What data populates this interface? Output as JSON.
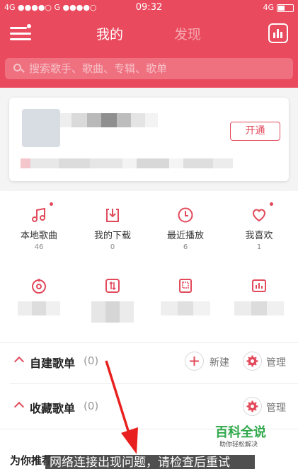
{
  "status_bar": {
    "carrier_left": "4G ●●●●○ G ●●●●○",
    "time": "09:32",
    "network_right": "4G"
  },
  "header": {
    "tabs": [
      {
        "label": "我的"
      },
      {
        "label": "发现"
      }
    ]
  },
  "search": {
    "placeholder": "搜索歌手、歌曲、专辑、歌单"
  },
  "profile": {
    "open_button_label": "开通"
  },
  "quick_grid": [
    {
      "label": "本地歌曲",
      "count": "46",
      "icon": "music-note-icon",
      "has_dot": true
    },
    {
      "label": "我的下载",
      "count": "0",
      "icon": "download-icon",
      "has_dot": false
    },
    {
      "label": "最近播放",
      "count": "6",
      "icon": "clock-icon",
      "has_dot": false
    },
    {
      "label": "我喜欢",
      "count": "1",
      "icon": "heart-icon",
      "has_dot": true
    }
  ],
  "second_row_icons": [
    "radio-icon",
    "transfer-icon",
    "device-icon",
    "equalizer-icon"
  ],
  "playlists": {
    "created": {
      "title": "自建歌单",
      "count": "(0)",
      "new_label": "新建",
      "manage_label": "管理"
    },
    "collected": {
      "title": "收藏歌单",
      "count": "(0)",
      "manage_label": "管理"
    }
  },
  "recommend_title": "为你推荐",
  "watermark": {
    "name": "百科全说",
    "tagline": "助你轻松解决"
  },
  "toast": "网络连接出现问题，请检查后重试",
  "colors": {
    "accent": "#ea4a5e",
    "watermark_green": "#2fa84a"
  }
}
